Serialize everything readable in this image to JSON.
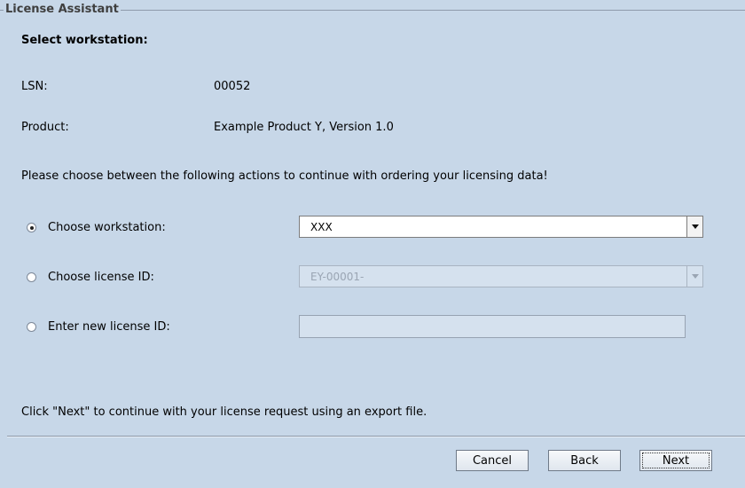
{
  "frame": {
    "title": "License Assistant"
  },
  "heading": "Select workstation:",
  "lsn": {
    "label": "LSN:",
    "value": "00052"
  },
  "product": {
    "label": "Product:",
    "value": "Example Product Y, Version  1.0"
  },
  "instruction": "Please choose between the following actions to continue with ordering your licensing data!",
  "options": {
    "workstation": {
      "label": "Choose workstation:",
      "selected": true,
      "value": "XXX"
    },
    "license_id": {
      "label": "Choose license ID:",
      "selected": false,
      "value": "EY-00001-"
    },
    "new_license_id": {
      "label": "Enter new license ID:",
      "selected": false,
      "value": ""
    }
  },
  "footer_text": "Click \"Next\" to continue with your license request using an export file.",
  "buttons": {
    "cancel": "Cancel",
    "back": "Back",
    "next": "Next"
  }
}
